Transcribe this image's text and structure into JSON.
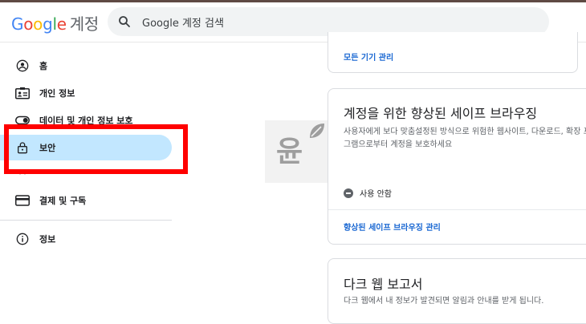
{
  "header": {
    "logo_parts": [
      "G",
      "o",
      "o",
      "g",
      "l",
      "e"
    ],
    "logo_suffix": "계정",
    "search_placeholder": "Google 계정 검색"
  },
  "sidebar": {
    "items": [
      {
        "label": "홈",
        "icon": "account-circle-icon"
      },
      {
        "label": "개인 정보",
        "icon": "id-card-icon"
      },
      {
        "label": "데이터 및 개인 정보 보호",
        "icon": "toggle-icon"
      },
      {
        "label": "보안",
        "icon": "lock-icon",
        "active": true
      },
      {
        "label": "",
        "icon": "people-icon"
      },
      {
        "label": "결제 및 구독",
        "icon": "credit-card-icon"
      },
      {
        "label": "정보",
        "icon": "info-icon"
      }
    ]
  },
  "watermark": {
    "text": "윤"
  },
  "cards": {
    "devices": {
      "link": "모든 기기 관리"
    },
    "safe_browsing": {
      "title": "계정을 위한 향상된 세이프 브라우징",
      "description": "사용자에게 보다 맞춤설정된 방식으로 위험한 웹사이트, 다운로드, 확장 프로그램으로부터 계정을 보호하세요",
      "status": "사용 안함",
      "link": "향상된 세이프 브라우징 관리"
    },
    "dark_web": {
      "title": "다크 웹 보고서",
      "description": "다크 웹에서 내 정보가 발견되면 알림과 안내를 받게 됩니다."
    }
  },
  "colors": {
    "active_nav": "#c2e7ff",
    "link": "#1967d2",
    "highlight": "#ff0000"
  }
}
